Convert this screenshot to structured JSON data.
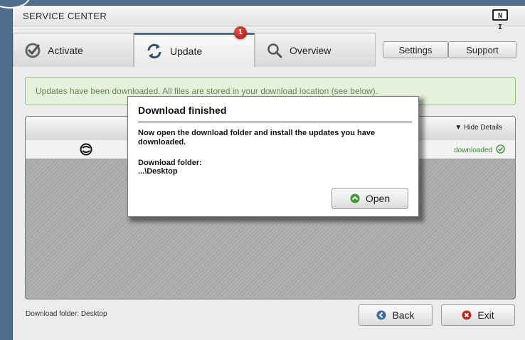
{
  "window": {
    "title": "SERVICE CENTER",
    "logo_text": "N I"
  },
  "tabs": [
    {
      "label": "Activate",
      "icon": "checkmark-icon",
      "active": false
    },
    {
      "label": "Update",
      "icon": "refresh-icon",
      "active": true,
      "badge": "1"
    },
    {
      "label": "Overview",
      "icon": "search-icon",
      "active": false
    }
  ],
  "top_buttons": {
    "settings": "Settings",
    "support": "Support"
  },
  "notice": {
    "text": "Updates have been downloaded. All files are stored in your download location (see below)."
  },
  "panel": {
    "hide_details_label": "Hide Details",
    "row": {
      "status": "downloaded",
      "icon": "traktor-logo-icon"
    }
  },
  "dialog": {
    "title": "Download finished",
    "message": "Now open the download folder and install the updates you have downloaded.",
    "folder_label": "Download folder:",
    "folder_path": "...\\Desktop",
    "open_label": "Open"
  },
  "footer": {
    "download_folder": "Download folder: Desktop",
    "back_label": "Back",
    "exit_label": "Exit"
  },
  "colors": {
    "accent_green": "#3f8a2e",
    "notice_border": "#8fc07a",
    "exit_red": "#c0271d",
    "back_blue": "#3a6b9a",
    "badge_red": "#b81c14"
  }
}
